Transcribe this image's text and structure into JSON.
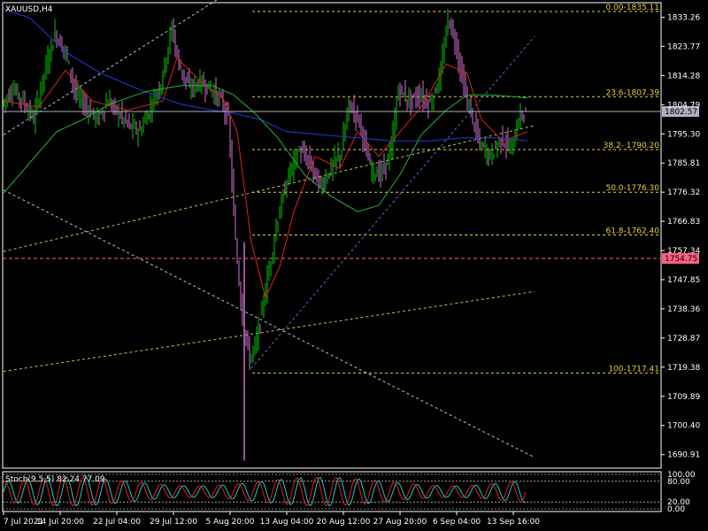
{
  "colors": {
    "background": "#000000",
    "axis": "#ffffff",
    "bull": "#00c800",
    "bear": "#d070d0",
    "ma_fast": "#e02020",
    "ma_mid": "#1e3cdc",
    "ma_slow": "#20b040",
    "fib": "#e8d030",
    "price_line": "#b0b0c0",
    "level_line": "#ff6080",
    "trend_blue": "#4a6fd8",
    "trend_white": "#c0c0d8",
    "trend_yellow": "#c8c050",
    "stoch_main": "#20c8c8",
    "stoch_signal": "#e02020"
  },
  "chart_data": [
    {
      "type": "candlestick",
      "title": "XAUUSD,H4",
      "y_ticks": [
        "1833.26",
        "1823.77",
        "1814.28",
        "1804.79",
        "1795.30",
        "1785.81",
        "1776.32",
        "1766.83",
        "1757.34",
        "1747.85",
        "1738.36",
        "1728.87",
        "1719.38",
        "1709.89",
        "1700.40",
        "1690.91"
      ],
      "ylim": [
        1686.5,
        1838
      ],
      "x_ticks": [
        "7 Jul 2021",
        "14 Jul 20:00",
        "22 Jul 04:00",
        "29 Jul 12:00",
        "5 Aug 20:00",
        "13 Aug 04:00",
        "20 Aug 12:00",
        "27 Aug 20:00",
        "6 Sep 04:00",
        "13 Sep 16:00"
      ],
      "x_tick_index": [
        0,
        32,
        64,
        96,
        128,
        160,
        192,
        224,
        256,
        288
      ],
      "bar_count": 300,
      "current_price": "1802.57",
      "current_price_value": 1802.57,
      "horizontal_level": "1754.75",
      "horizontal_level_value": 1754.75,
      "fibonacci": [
        {
          "label": "0.00-1835.11",
          "value": 1835.11
        },
        {
          "label": "23.6-1807.39",
          "value": 1807.39
        },
        {
          "label": "38.2- 1790.20",
          "value": 1790.2
        },
        {
          "label": "50.0-1776.30",
          "value": 1776.3
        },
        {
          "label": "61.8-1762.40",
          "value": 1762.4
        },
        {
          "label": "100-1717.41",
          "value": 1717.41
        }
      ],
      "price_path": [
        [
          0,
          1805
        ],
        [
          6,
          1810
        ],
        [
          12,
          1806
        ],
        [
          18,
          1800
        ],
        [
          24,
          1815
        ],
        [
          30,
          1828
        ],
        [
          36,
          1822
        ],
        [
          42,
          1808
        ],
        [
          48,
          1804
        ],
        [
          54,
          1800
        ],
        [
          60,
          1806
        ],
        [
          66,
          1802
        ],
        [
          72,
          1798
        ],
        [
          78,
          1796
        ],
        [
          84,
          1804
        ],
        [
          90,
          1812
        ],
        [
          96,
          1830
        ],
        [
          100,
          1818
        ],
        [
          106,
          1810
        ],
        [
          112,
          1812
        ],
        [
          118,
          1810
        ],
        [
          124,
          1806
        ],
        [
          128,
          1800
        ],
        [
          132,
          1760
        ],
        [
          136,
          1735
        ],
        [
          140,
          1722
        ],
        [
          144,
          1728
        ],
        [
          150,
          1748
        ],
        [
          156,
          1768
        ],
        [
          162,
          1782
        ],
        [
          168,
          1790
        ],
        [
          174,
          1786
        ],
        [
          180,
          1778
        ],
        [
          186,
          1784
        ],
        [
          192,
          1790
        ],
        [
          196,
          1805
        ],
        [
          202,
          1800
        ],
        [
          208,
          1784
        ],
        [
          214,
          1782
        ],
        [
          220,
          1790
        ],
        [
          224,
          1810
        ],
        [
          230,
          1806
        ],
        [
          236,
          1808
        ],
        [
          242,
          1805
        ],
        [
          248,
          1815
        ],
        [
          252,
          1833
        ],
        [
          256,
          1826
        ],
        [
          262,
          1808
        ],
        [
          266,
          1800
        ],
        [
          270,
          1792
        ],
        [
          276,
          1788
        ],
        [
          282,
          1794
        ],
        [
          288,
          1790
        ],
        [
          292,
          1800
        ],
        [
          296,
          1803
        ]
      ],
      "moving_averages": [
        {
          "color_key": "ma_fast",
          "path": [
            [
              0,
              1806
            ],
            [
              20,
              1804
            ],
            [
              35,
              1816
            ],
            [
              50,
              1806
            ],
            [
              70,
              1803
            ],
            [
              90,
              1806
            ],
            [
              98,
              1820
            ],
            [
              112,
              1812
            ],
            [
              124,
              1807
            ],
            [
              132,
              1796
            ],
            [
              140,
              1760
            ],
            [
              148,
              1742
            ],
            [
              156,
              1752
            ],
            [
              164,
              1770
            ],
            [
              176,
              1788
            ],
            [
              190,
              1784
            ],
            [
              200,
              1796
            ],
            [
              212,
              1788
            ],
            [
              224,
              1796
            ],
            [
              236,
              1804
            ],
            [
              250,
              1818
            ],
            [
              262,
              1815
            ],
            [
              270,
              1800
            ],
            [
              282,
              1793
            ],
            [
              296,
              1796
            ]
          ]
        },
        {
          "color_key": "ma_mid",
          "path": [
            [
              0,
              1836
            ],
            [
              15,
              1833
            ],
            [
              35,
              1822
            ],
            [
              55,
              1815
            ],
            [
              80,
              1809
            ],
            [
              100,
              1805
            ],
            [
              118,
              1803
            ],
            [
              130,
              1802
            ],
            [
              145,
              1800
            ],
            [
              160,
              1796
            ],
            [
              180,
              1795
            ],
            [
              200,
              1794
            ],
            [
              220,
              1793
            ],
            [
              240,
              1793
            ],
            [
              260,
              1794
            ],
            [
              280,
              1794
            ],
            [
              296,
              1793
            ]
          ]
        },
        {
          "color_key": "ma_slow",
          "path": [
            [
              0,
              1776
            ],
            [
              15,
              1786
            ],
            [
              30,
              1796
            ],
            [
              45,
              1800
            ],
            [
              60,
              1805
            ],
            [
              80,
              1809
            ],
            [
              100,
              1811
            ],
            [
              118,
              1811
            ],
            [
              130,
              1808
            ],
            [
              142,
              1802
            ],
            [
              155,
              1794
            ],
            [
              170,
              1782
            ],
            [
              185,
              1775
            ],
            [
              200,
              1770
            ],
            [
              212,
              1772
            ],
            [
              224,
              1782
            ],
            [
              236,
              1795
            ],
            [
              250,
              1803
            ],
            [
              262,
              1808
            ],
            [
              276,
              1808
            ],
            [
              296,
              1807
            ]
          ]
        }
      ],
      "trendlines": [
        {
          "color_key": "trend_blue",
          "from": [
            140,
            1719
          ],
          "to": [
            300,
            1827
          ]
        },
        {
          "color_key": "trend_white",
          "from": [
            0,
            1777
          ],
          "to": [
            300,
            1690
          ]
        },
        {
          "color_key": "trend_yellow",
          "from": [
            0,
            1757
          ],
          "to": [
            300,
            1798
          ]
        },
        {
          "color_key": "trend_yellow",
          "from": [
            0,
            1718
          ],
          "to": [
            300,
            1744
          ]
        },
        {
          "color_key": "trend_white",
          "from": [
            0,
            1795
          ],
          "to": [
            140,
            1846
          ]
        }
      ]
    },
    {
      "type": "line",
      "title": "Stoch(9,5,5) 82.24 77.09",
      "y_ticks": [
        "100.00",
        "80.00",
        "20.00",
        "0.00"
      ],
      "ylim": [
        0,
        100
      ],
      "series": [
        {
          "color_key": "stoch_main",
          "wave_period": 11,
          "offset": 0
        },
        {
          "color_key": "stoch_signal",
          "wave_period": 11,
          "offset": 2
        }
      ]
    }
  ]
}
